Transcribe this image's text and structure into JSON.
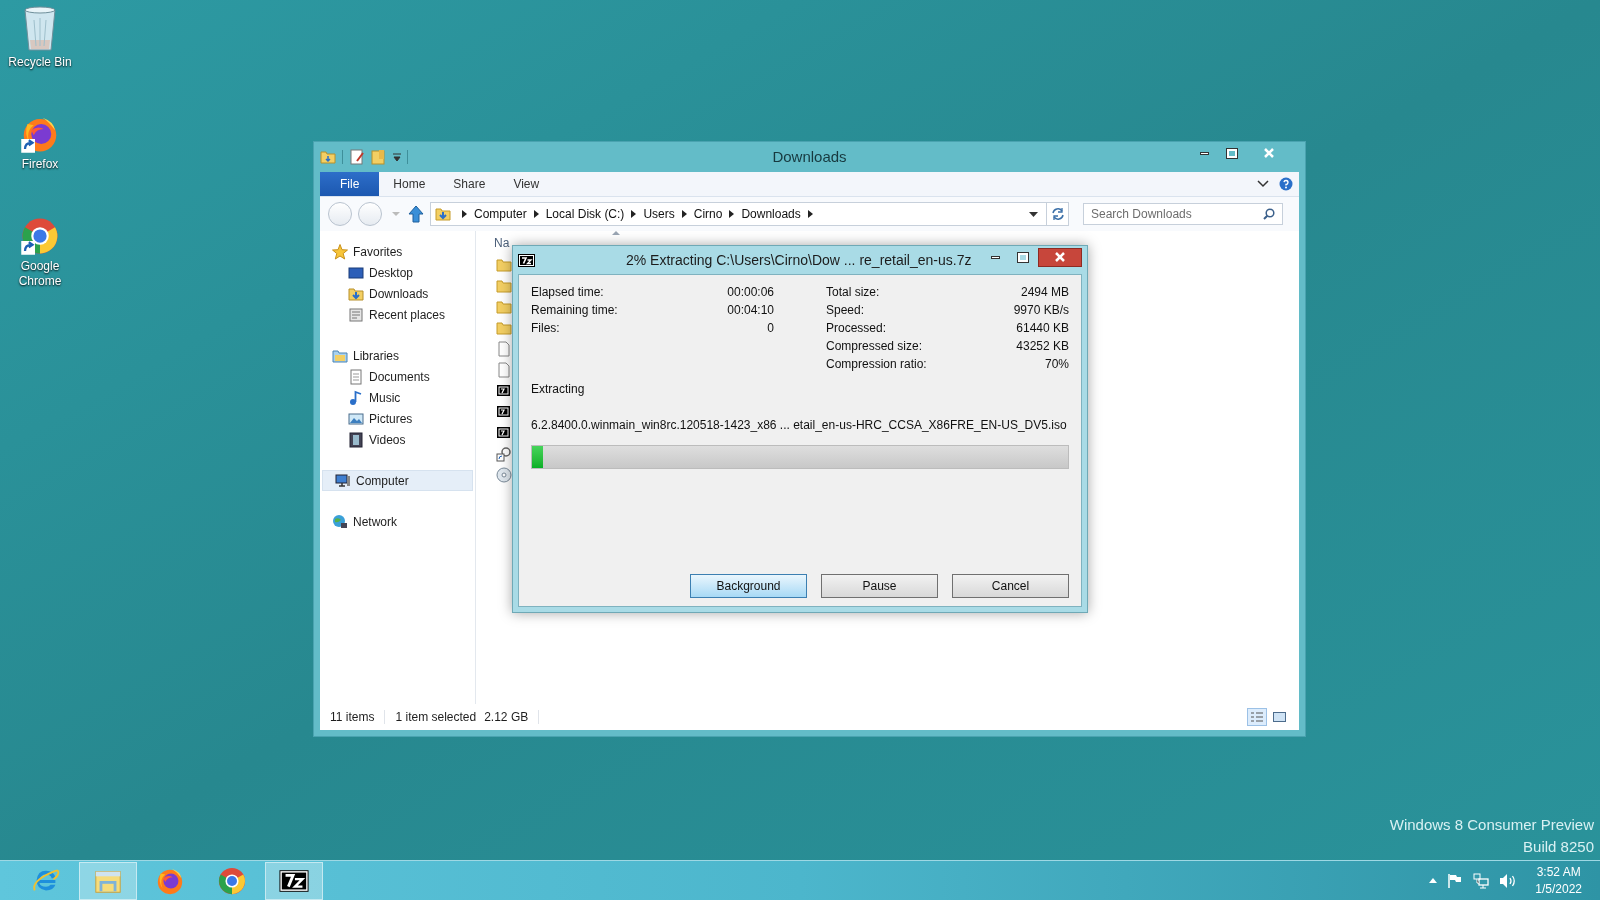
{
  "desktop_icons": [
    {
      "label": "Recycle Bin",
      "kind": "recycle"
    },
    {
      "label": "Firefox",
      "kind": "firefox"
    },
    {
      "label": "Google Chrome",
      "kind": "chrome"
    }
  ],
  "explorer": {
    "title": "Downloads",
    "ribbon_tabs": [
      {
        "label": "File",
        "kind": "file"
      },
      {
        "label": "Home",
        "kind": "tab"
      },
      {
        "label": "Share",
        "kind": "tab"
      },
      {
        "label": "View",
        "kind": "tab"
      }
    ],
    "breadcrumbs": [
      "Computer",
      "Local Disk (C:)",
      "Users",
      "Cirno",
      "Downloads"
    ],
    "search": {
      "placeholder": "Search Downloads"
    },
    "nav": [
      {
        "label": "Favorites",
        "kind": "star",
        "selected": false,
        "children": [
          {
            "label": "Desktop",
            "kind": "desktop",
            "selected": false
          },
          {
            "label": "Downloads",
            "kind": "downloads",
            "selected": false
          },
          {
            "label": "Recent places",
            "kind": "recent",
            "selected": false
          }
        ]
      },
      {
        "label": "Libraries",
        "kind": "library",
        "selected": false,
        "children": [
          {
            "label": "Documents",
            "kind": "document",
            "selected": false
          },
          {
            "label": "Music",
            "kind": "music",
            "selected": false
          },
          {
            "label": "Pictures",
            "kind": "pictures",
            "selected": false
          },
          {
            "label": "Videos",
            "kind": "videos",
            "selected": false
          }
        ]
      },
      {
        "label": "Computer",
        "kind": "computer",
        "selected": true
      },
      {
        "label": "Network",
        "kind": "network",
        "selected": false
      }
    ],
    "columns": [
      {
        "label": "Na"
      }
    ],
    "files": [
      {
        "kind": "folder"
      },
      {
        "kind": "folder"
      },
      {
        "kind": "folder"
      },
      {
        "kind": "folder"
      },
      {
        "kind": "file"
      },
      {
        "kind": "file"
      },
      {
        "kind": "archive"
      },
      {
        "kind": "archive"
      },
      {
        "kind": "archive"
      },
      {
        "kind": "shortcut"
      },
      {
        "kind": "disc"
      }
    ],
    "status_bar": {
      "count": "11 items",
      "selection": "1 item selected",
      "size": "2.12 GB"
    }
  },
  "dialog": {
    "title": "2% Extracting C:\\Users\\Cirno\\Dow ... re_retail_en-us.7z",
    "left_stats": [
      {
        "label": "Elapsed time:",
        "value": "00:00:06"
      },
      {
        "label": "Remaining time:",
        "value": "00:04:10"
      },
      {
        "label": "Files:",
        "value": "0"
      }
    ],
    "right_stats": [
      {
        "label": "Total size:",
        "value": "2494 MB"
      },
      {
        "label": "Speed:",
        "value": "9970 KB/s"
      },
      {
        "label": "Processed:",
        "value": "61440 KB"
      },
      {
        "label": "Compressed size:",
        "value": "43252 KB"
      },
      {
        "label": "Compression ratio:",
        "value": "70%"
      }
    ],
    "status": "Extracting",
    "file": "6.2.8400.0.winmain_win8rc.120518-1423_x86 ... etail_en-us-HRC_CCSA_X86FRE_EN-US_DV5.iso",
    "progress": {
      "level": 0.02
    },
    "buttons": [
      {
        "label": "Background",
        "hovered": true
      },
      {
        "label": "Pause",
        "hovered": false
      },
      {
        "label": "Cancel",
        "hovered": false
      }
    ]
  },
  "edition_text": [
    "Windows 8 Consumer Preview",
    "Build 8250"
  ],
  "taskbar": {
    "apps": [
      {
        "kind": "ie",
        "active": false
      },
      {
        "kind": "explorer",
        "active": true
      },
      {
        "kind": "firefox",
        "active": false
      },
      {
        "kind": "chrome",
        "active": false
      },
      {
        "kind": "archiver",
        "active": true
      }
    ],
    "clock_time": "3:52 AM",
    "clock_date": "1/5/2022"
  }
}
